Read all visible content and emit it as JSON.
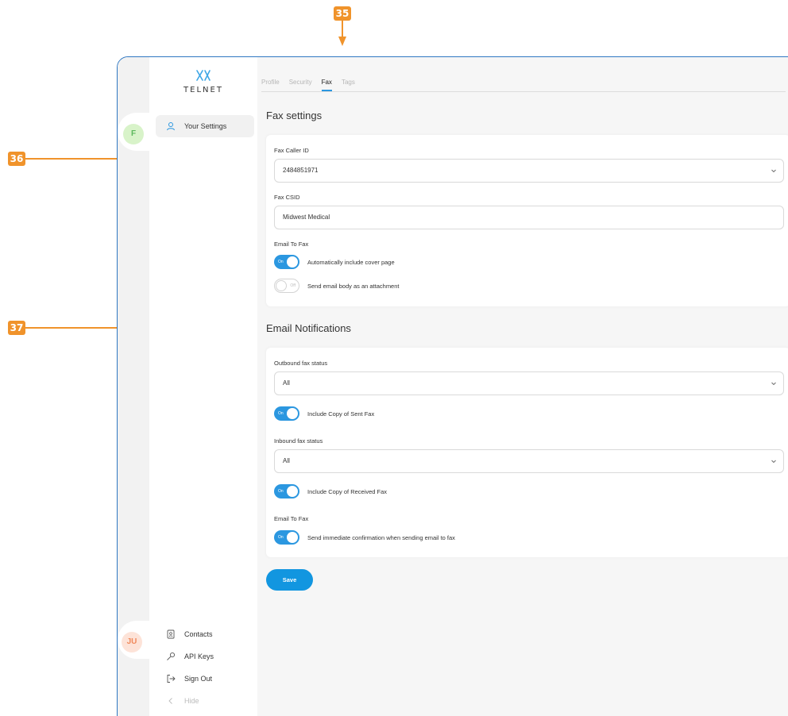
{
  "annotations": {
    "callout_35": "35",
    "callout_36": "36",
    "callout_37": "37"
  },
  "brand": {
    "name": "TELNET"
  },
  "rail": {
    "avatar_top": "F",
    "avatar_bottom": "JU"
  },
  "sidebar": {
    "items": [
      {
        "label": "Your Settings",
        "icon": "user-icon"
      }
    ],
    "bottom_items": [
      {
        "label": "Contacts",
        "icon": "contacts-icon"
      },
      {
        "label": "API Keys",
        "icon": "key-icon"
      },
      {
        "label": "Sign Out",
        "icon": "sign-out-icon"
      },
      {
        "label": "Hide",
        "icon": "chevron-left-icon"
      }
    ]
  },
  "tabs": [
    {
      "label": "Profile"
    },
    {
      "label": "Security"
    },
    {
      "label": "Fax"
    },
    {
      "label": "Tags"
    }
  ],
  "active_tab": "Fax",
  "fax_settings": {
    "title": "Fax settings",
    "caller_id_label": "Fax Caller ID",
    "caller_id_value": "2484851971",
    "csid_label": "Fax CSID",
    "csid_value": "Midwest Medical",
    "email_to_fax_label": "Email To Fax",
    "toggles": [
      {
        "state": "On",
        "label": "Automatically include cover page"
      },
      {
        "state": "Off",
        "label": "Send email body as an attachment"
      }
    ]
  },
  "email_notifications": {
    "title": "Email Notifications",
    "outbound_label": "Outbound fax status",
    "outbound_value": "All",
    "outbound_toggle": {
      "state": "On",
      "label": "Include Copy of Sent Fax"
    },
    "inbound_label": "Inbound fax status",
    "inbound_value": "All",
    "inbound_toggle": {
      "state": "On",
      "label": "Include Copy of Received Fax"
    },
    "email_to_fax_label": "Email To Fax",
    "email_to_fax_toggle": {
      "state": "On",
      "label": "Send immediate confirmation when sending email to fax"
    }
  },
  "save_label": "Save",
  "colors": {
    "accent": "#2b97e0",
    "callout": "#f0932b",
    "frame_border": "#2f77c2"
  }
}
